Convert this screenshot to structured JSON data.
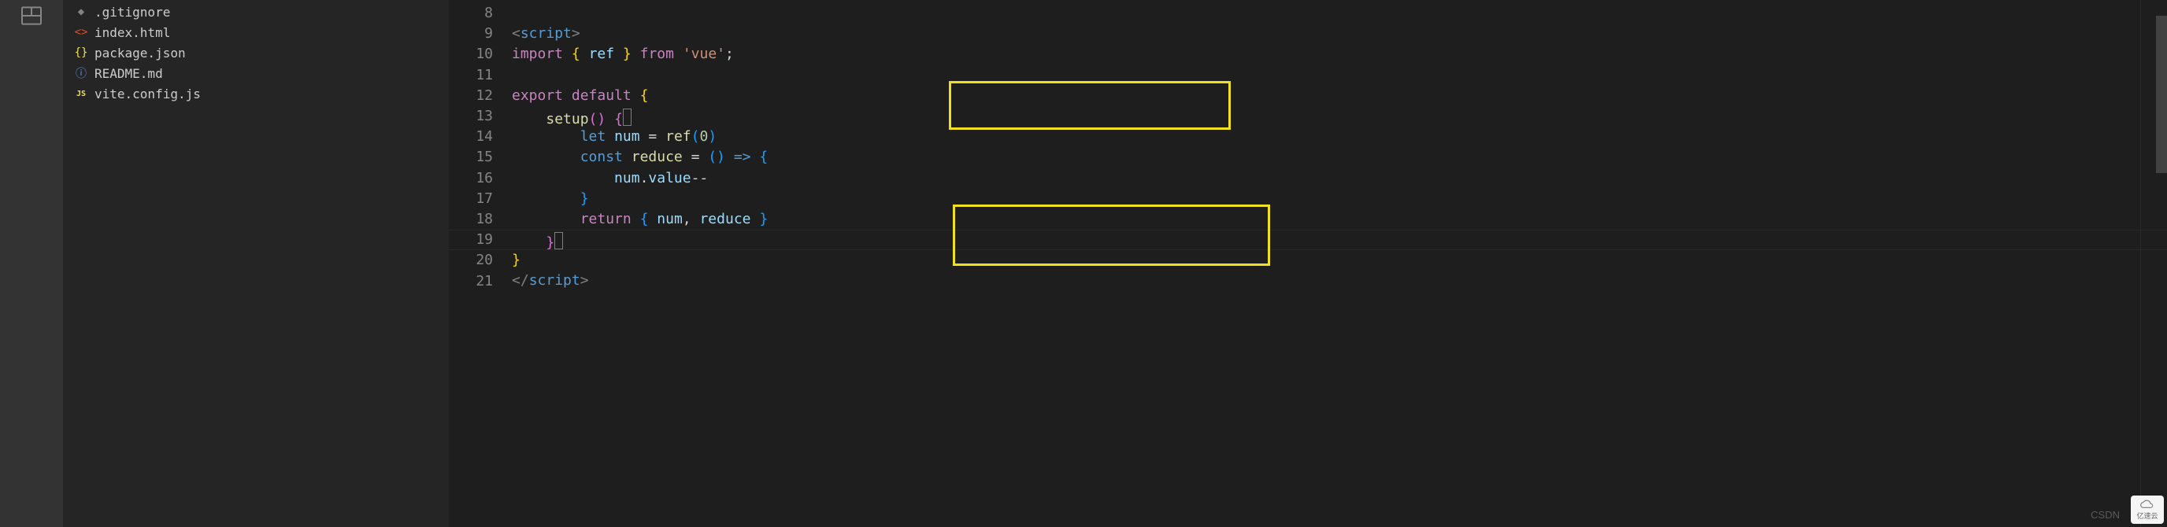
{
  "sidebar": {
    "files": [
      {
        "icon": "◆",
        "iconClass": "icon-git",
        "name": ".gitignore"
      },
      {
        "icon": "<>",
        "iconClass": "icon-html",
        "name": "index.html"
      },
      {
        "icon": "{}",
        "iconClass": "icon-json",
        "name": "package.json"
      },
      {
        "icon": "ⓘ",
        "iconClass": "icon-info",
        "name": "README.md"
      },
      {
        "icon": "JS",
        "iconClass": "icon-js",
        "name": "vite.config.js"
      }
    ]
  },
  "editor": {
    "lineStart": 8,
    "lines": [
      {
        "n": "8",
        "html": ""
      },
      {
        "n": "9",
        "html": "<span class='tok-tag'>&lt;</span><span class='tok-tagname'>script</span><span class='tok-tag'>&gt;</span>"
      },
      {
        "n": "10",
        "html": "<span class='tok-keyword-import'>import</span> <span class='tok-brace'>{</span> <span class='tok-var'>ref</span> <span class='tok-brace'>}</span> <span class='tok-keyword-from'>from</span> <span class='tok-string'>'vue'</span><span class='tok-punct'>;</span>"
      },
      {
        "n": "11",
        "html": ""
      },
      {
        "n": "12",
        "html": "<span class='tok-keyword-export'>export</span> <span class='tok-keyword-export'>default</span> <span class='tok-brace'>{</span>"
      },
      {
        "n": "13",
        "html": "<span class='indent-guide'>    </span><span class='tok-func'>setup</span><span class='tok-paren'>()</span> <span class='tok-paren'>{</span><span class='cursor-box'></span>"
      },
      {
        "n": "14",
        "html": "<span class='indent-guide'>        </span><span class='tok-keyword-let'>let</span> <span class='tok-var'>num</span> <span class='tok-op'>=</span> <span class='tok-func'>ref</span><span class='tok-paren2'>(</span><span class='tok-num'>0</span><span class='tok-paren2'>)</span>"
      },
      {
        "n": "15",
        "html": "<span class='indent-guide'>        </span><span class='tok-keyword-const'>const</span> <span class='tok-func'>reduce</span> <span class='tok-op'>=</span> <span class='tok-paren2'>()</span> <span class='tok-keyword-const'>=&gt;</span> <span class='tok-paren2'>{</span>"
      },
      {
        "n": "16",
        "html": "<span class='indent-guide'>            </span><span class='tok-var'>num</span><span class='tok-punct'>.</span><span class='tok-prop'>value</span><span class='tok-op'>--</span>"
      },
      {
        "n": "17",
        "html": "<span class='indent-guide'>        </span><span class='tok-paren2'>}</span>"
      },
      {
        "n": "18",
        "html": "<span class='indent-guide'>        </span><span class='tok-keyword-return'>return</span> <span class='tok-paren2'>{</span> <span class='tok-var'>num</span><span class='tok-punct'>,</span> <span class='tok-var'>reduce</span> <span class='tok-paren2'>}</span>"
      },
      {
        "n": "19",
        "html": "<span class='indent-guide'>    </span><span class='tok-paren'>}</span><span class='cursor-box'></span>"
      },
      {
        "n": "20",
        "html": "<span class='tok-brace'>}</span>"
      },
      {
        "n": "21",
        "html": "<span class='tok-tag'>&lt;/</span><span class='tok-tagname'>script</span><span class='tok-tag'>&gt;</span>"
      }
    ]
  },
  "watermark": {
    "left": "CSDN",
    "right": "亿速云"
  }
}
